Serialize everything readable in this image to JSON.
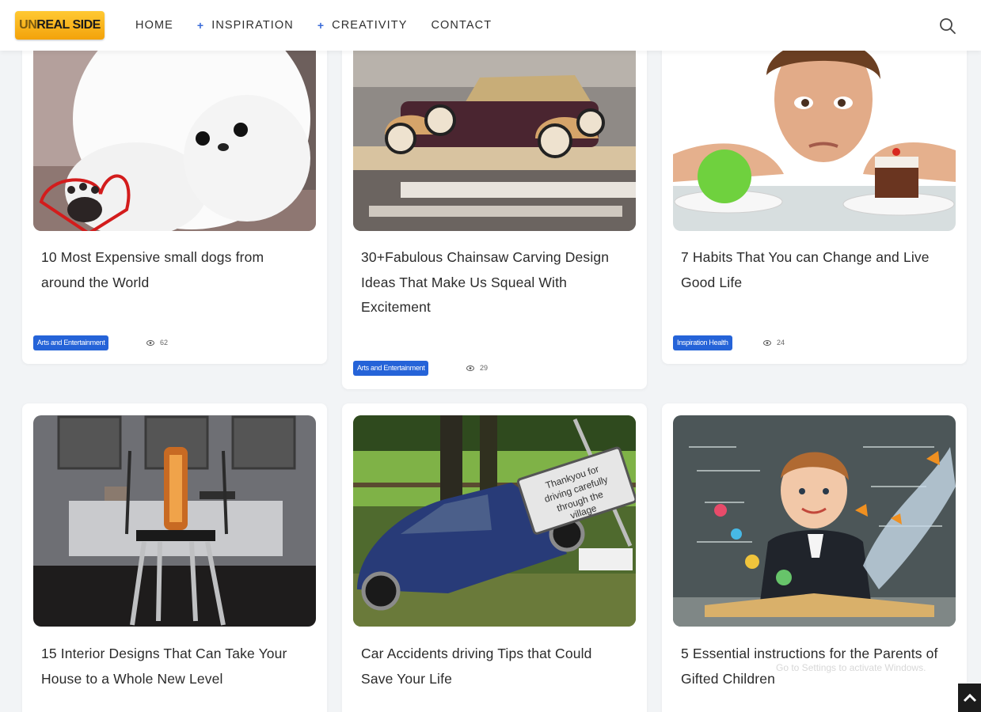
{
  "header": {
    "logo": {
      "prefix": "UN",
      "main": "REAL SIDE"
    },
    "nav": [
      {
        "label": "HOME",
        "plus": ""
      },
      {
        "label": "INSPIRATION",
        "plus": "+"
      },
      {
        "label": "CREATIVITY",
        "plus": "+"
      },
      {
        "label": "CONTACT",
        "plus": ""
      }
    ],
    "search_icon": "search-icon"
  },
  "posts": [
    {
      "title": "10 Most Expensive small dogs from around the World",
      "category": "Arts and Entertainment",
      "views": "62"
    },
    {
      "title": "30+Fabulous Chainsaw Carving Design Ideas That Make Us Squeal With Excitement",
      "category": "Arts and Entertainment",
      "views": "29"
    },
    {
      "title": "7 Habits That You can Change and Live Good Life",
      "category": "Inspiration Health",
      "views": "24"
    },
    {
      "title": "15 Interior Designs That Can Take Your House to a Whole New Level"
    },
    {
      "title": "Car Accidents driving Tips that Could Save Your Life"
    },
    {
      "title": "5 Essential instructions for the Parents of Gifted Children"
    }
  ],
  "sign_text": "Thankyou for driving carefully through the village",
  "watermark": "Go to Settings to activate Windows.",
  "colors": {
    "tag": "#2563d8",
    "logo": "#f7b21a",
    "nav_plus": "#3a6bd8",
    "background": "#f2f4f6"
  }
}
